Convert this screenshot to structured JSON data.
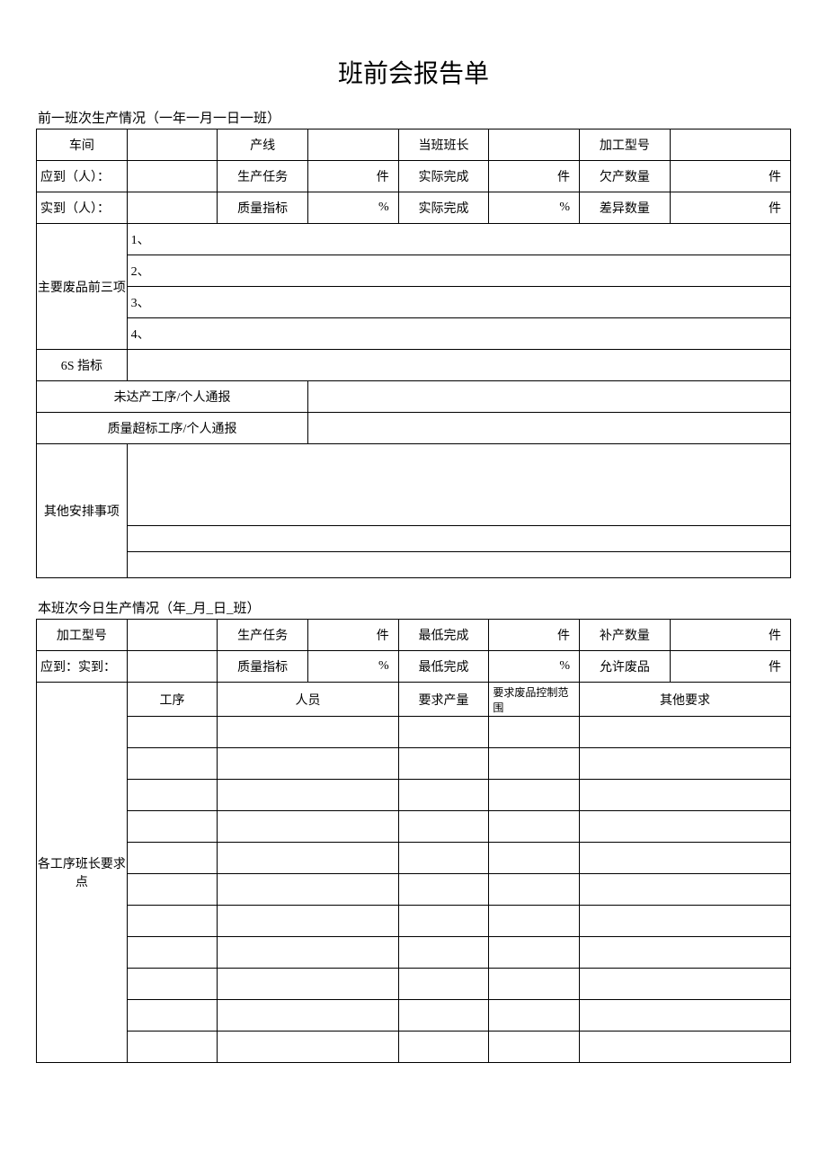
{
  "title": "班前会报告单",
  "section1_label": "前一班次生产情况（一年一月一日一班）",
  "t1": {
    "r1c1": "车间",
    "r1c3": "产线",
    "r1c5": "当班班长",
    "r1c7": "加工型号",
    "r2c1": "应到（人）：",
    "r2c3": "生产任务",
    "r2c4": "件",
    "r2c5": "实际完成",
    "r2c6": "件",
    "r2c7": "欠产数量",
    "r2c8": "件",
    "r3c1": "实到（人）：",
    "r3c3": "质量指标",
    "r3c4": "%",
    "r3c5": "实际完成",
    "r3c6": "%",
    "r3c7": "差异数量",
    "r3c8": "件",
    "waste_label": "主要废品前三项",
    "w1": "1、",
    "w2": "2、",
    "w3": "3、",
    "w4": "4、",
    "six_s": "6S 指标",
    "not_reached": "未达产工序/个人通报",
    "quality_over": "质量超标工序/个人通报",
    "other_arrange": "其他安排事项"
  },
  "section2_label": "本班次今日生产情况（年_月_日_班）",
  "t2": {
    "r1c1": "加工型号",
    "r1c3": "生产任务",
    "r1c4": "件",
    "r1c5": "最低完成",
    "r1c6": "件",
    "r1c7": "补产数量",
    "r1c8": "件",
    "r2c1": "应到：实到：",
    "r2c3": "质量指标",
    "r2c4": "%",
    "r2c5": "最低完成",
    "r2c6": "%",
    "r2c7": "允许废品",
    "r2c8": "件",
    "req_label": "各工序班长要求点",
    "h_process": "工序",
    "h_person": "人员",
    "h_output": "要求产量",
    "h_waste": "要求废品控制范围",
    "h_other": "其他要求"
  }
}
